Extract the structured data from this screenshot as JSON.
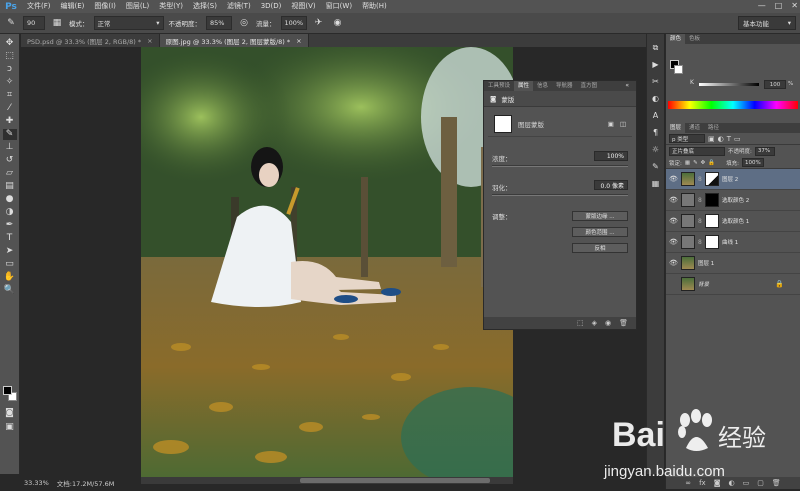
{
  "app": {
    "logo": "Ps"
  },
  "menu": [
    "文件(F)",
    "编辑(E)",
    "图像(I)",
    "图层(L)",
    "类型(Y)",
    "选择(S)",
    "滤镜(T)",
    "3D(D)",
    "视图(V)",
    "窗口(W)",
    "帮助(H)"
  ],
  "window_controls": [
    "—",
    "□",
    "✕"
  ],
  "options": {
    "brush_size": "90",
    "mode_label": "模式：",
    "mode_value": "正常",
    "opacity_label": "不透明度：",
    "opacity_value": "85%",
    "flow_label": "流量：",
    "flow_value": "100%",
    "workspace": "基本功能"
  },
  "tabs": [
    {
      "label": "PSD.psd @ 33.3% (图层 2, RGB/8) *",
      "close": "×",
      "active": false
    },
    {
      "label": "原图.jpg @ 33.3% (图层 2, 图层蒙版/8) *",
      "close": "×",
      "active": true
    }
  ],
  "status": {
    "zoom": "33.33%",
    "doc": "文档:17.2M/57.6M"
  },
  "properties": {
    "tabs": [
      "工具预设",
      "属性",
      "信息",
      "导航器",
      "直方图"
    ],
    "active_tab": 1,
    "collapse": "«",
    "header": "蒙版",
    "type_label": "图层蒙版",
    "density_label": "浓度：",
    "density_value": "100%",
    "feather_label": "羽化：",
    "feather_value": "0.0 像素",
    "refine_label": "调整：",
    "btn_edge": "蒙版边缘 ...",
    "btn_range": "颜色范围 ...",
    "btn_invert": "反相"
  },
  "color_panel": {
    "tabs": [
      "颜色",
      "色板"
    ],
    "channel": "K",
    "value": "100",
    "unit": "%"
  },
  "layers_panel": {
    "tabs": [
      "图层",
      "通道",
      "路径"
    ],
    "kind": "p 类型",
    "blend": "正片叠底",
    "opacity_label": "不透明度:",
    "opacity_value": "37%",
    "lock_label": "锁定:",
    "fill_label": "填充:",
    "fill_value": "100%",
    "layers": [
      {
        "name": "图层 2",
        "selected": true
      },
      {
        "name": "选取颜色 2",
        "selected": false
      },
      {
        "name": "选取颜色 1",
        "selected": false
      },
      {
        "name": "曲线 1",
        "selected": false
      },
      {
        "name": "图层 1",
        "selected": false
      },
      {
        "name": "背景",
        "selected": false
      }
    ]
  },
  "watermark": {
    "brand": "Bai",
    "brand2": "经验",
    "url": "jingyan.baidu.com"
  },
  "colors": {
    "accent": "#4aa3e8",
    "panel": "#535353",
    "selected_layer": "#5e6e85"
  }
}
